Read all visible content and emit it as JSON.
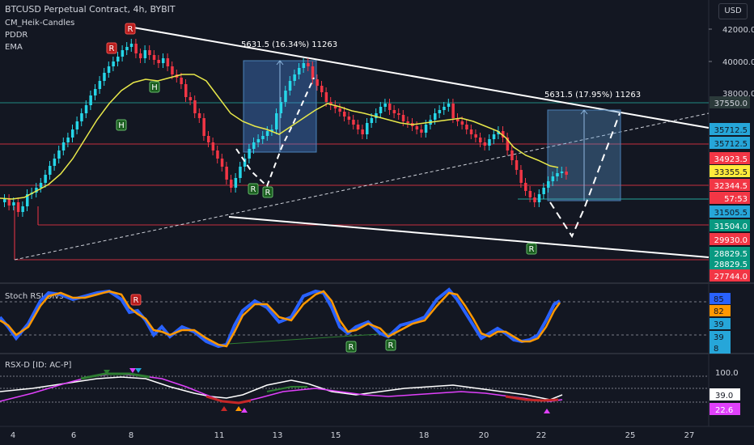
{
  "header": {
    "symbol": "BTCUSD Perpetual Contract, 4h, BYBIT",
    "indicators": [
      "CM_Heik-Candles",
      "PDDR",
      "EMA"
    ],
    "currency_button": "USD"
  },
  "main_axis": {
    "ticks": [
      "42000.0",
      "40000.0",
      "38000.0"
    ],
    "price_labels": [
      {
        "text": "37550.0",
        "color": "#2b3a3a",
        "text_color": "#d1d4dc",
        "value": 37550
      },
      {
        "text": "35712.5",
        "color": "#26a6d9",
        "text_color": "#131722",
        "value": 35712.5
      },
      {
        "text": "35712.5",
        "color": "#26a6d9",
        "text_color": "#131722",
        "value": 35712.5
      },
      {
        "text": "34923.5",
        "color": "#f23645",
        "text_color": "#ffffff",
        "value": 34923.5
      },
      {
        "text": "33355.5",
        "color": "#ffeb3b",
        "text_color": "#131722",
        "value": 33355.5
      },
      {
        "text": "32344.5",
        "color": "#f23645",
        "text_color": "#ffffff",
        "value": 32344.5
      },
      {
        "text": "57:53",
        "color": "#f23645",
        "text_color": "#ffffff",
        "value": null
      },
      {
        "text": "31505.5",
        "color": "#26a6d9",
        "text_color": "#131722",
        "value": 31505.5
      },
      {
        "text": "31504.0",
        "color": "#089981",
        "text_color": "#ffffff",
        "value": 31504
      },
      {
        "text": "29930.0",
        "color": "#f23645",
        "text_color": "#ffffff",
        "value": 29930
      },
      {
        "text": "28829.5",
        "color": "#089981",
        "text_color": "#ffffff",
        "value": 28829.5
      },
      {
        "text": "28829.5",
        "color": "#089981",
        "text_color": "#ffffff",
        "value": 28829.5
      },
      {
        "text": "27744.0",
        "color": "#f23645",
        "text_color": "#ffffff",
        "value": 27744
      }
    ]
  },
  "annotations": {
    "measure_left": "5631.5 (16.34%) 11263",
    "measure_right": "5631.5 (17.95%) 11263",
    "labels_R": [
      "R",
      "R",
      "R",
      "R",
      "R"
    ],
    "labels_H": [
      "H",
      "H"
    ]
  },
  "rsi_pane": {
    "title": "Stoch RSI Divs",
    "values": [
      {
        "text": "85",
        "color": "#2962ff"
      },
      {
        "text": "82",
        "color": "#ff9800"
      },
      {
        "text": "39",
        "color": "#26a6d9"
      },
      {
        "text": "39",
        "color": "#26a6d9"
      },
      {
        "text": "8",
        "color": "#26a6d9"
      }
    ],
    "labels": [
      "R",
      "R",
      "R"
    ]
  },
  "rsx_pane": {
    "title": "RSX-D [ID: AC-P]",
    "values": [
      {
        "text": "100.0",
        "color": "#131722",
        "text_color": "#d1d4dc"
      },
      {
        "text": "39.0",
        "color": "#ffffff",
        "text_color": "#131722"
      },
      {
        "text": "22.6",
        "color": "#e040fb",
        "text_color": "#ffffff"
      }
    ]
  },
  "time_axis": {
    "labels": [
      "4",
      "6",
      "8",
      "11",
      "13",
      "15",
      "18",
      "20",
      "22",
      "25",
      "27"
    ]
  }
}
